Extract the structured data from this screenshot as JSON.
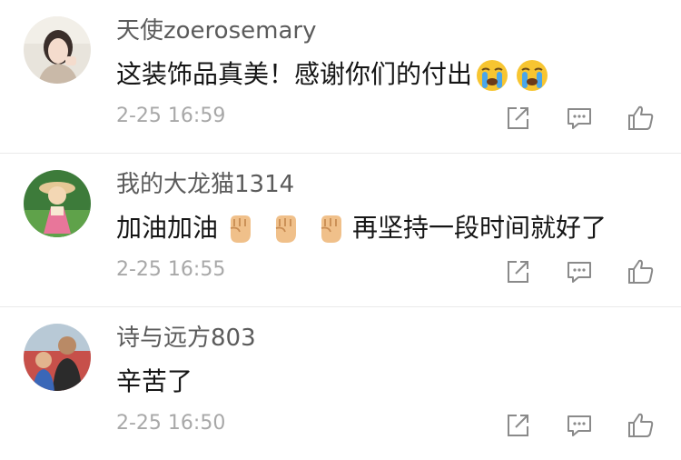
{
  "comments": [
    {
      "username": "天使zoerosemary",
      "content_before": "这装饰品真美！感谢你们的付出",
      "content_after": "",
      "emoji": [
        "crying-face",
        "crying-face"
      ],
      "time": "2-25 16:59"
    },
    {
      "username": "我的大龙猫1314",
      "content_before": "加油加油",
      "content_after": "再坚持一段时间就好了",
      "emoji": [
        "raised-fist",
        "raised-fist",
        "raised-fist"
      ],
      "time": "2-25 16:55"
    },
    {
      "username": "诗与远方803",
      "content_before": "辛苦了",
      "content_after": "",
      "emoji": [],
      "time": "2-25 16:50"
    }
  ],
  "actions": [
    "share-icon",
    "comment-icon",
    "like-icon"
  ],
  "colors": {
    "username": "#5b5b5b",
    "content": "#151515",
    "time": "#a8a8a8",
    "divider": "#e9e9e9"
  }
}
